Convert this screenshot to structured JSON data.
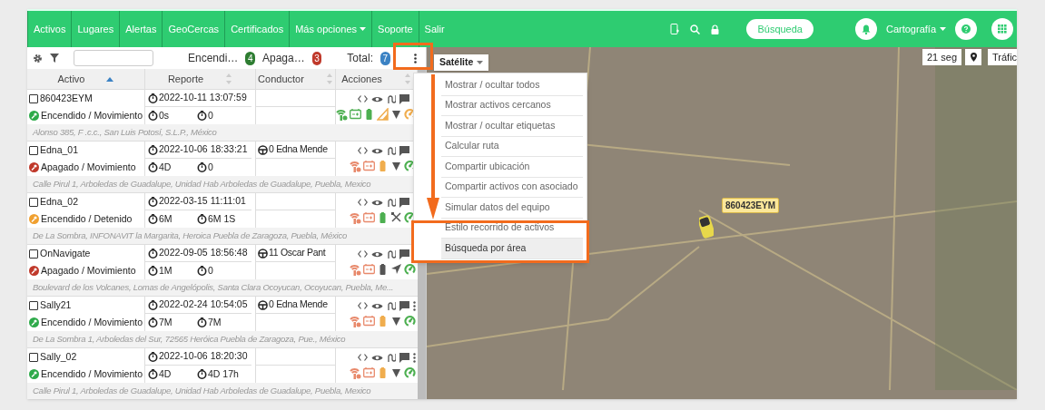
{
  "nav": {
    "items": [
      {
        "label": "Activos",
        "dropdown": false
      },
      {
        "label": "Lugares",
        "dropdown": false
      },
      {
        "label": "Alertas",
        "dropdown": false
      },
      {
        "label": "GeoCercas",
        "dropdown": false
      },
      {
        "label": "Certificados",
        "dropdown": false
      },
      {
        "label": "Más opciones",
        "dropdown": true
      },
      {
        "label": "Soporte",
        "dropdown": false
      },
      {
        "label": "Salir",
        "dropdown": false
      }
    ],
    "search_button": "Búsqueda",
    "profile_menu": "Cartografía"
  },
  "toolbar": {
    "counters": [
      {
        "label": "Encendi…",
        "count": "4",
        "color": "#2e7d32"
      },
      {
        "label": "Apaga…",
        "count": "3",
        "color": "#c0392b"
      },
      {
        "label": "Total:",
        "count": "7",
        "color": "#3b82c4"
      }
    ]
  },
  "table": {
    "columns": [
      {
        "label": "Activo",
        "sorted": true
      },
      {
        "label": "Reporte",
        "sorted": false
      },
      {
        "label": "Conductor",
        "sorted": false
      },
      {
        "label": "Acciones",
        "sorted": false
      }
    ],
    "rows": [
      {
        "name": "860423EYM",
        "checked": false,
        "status": "Encendido / Movimiento",
        "color": "#2eaa4a",
        "report": "2022-10-11 13:07:59",
        "elapsed": [
          "0s",
          "0"
        ],
        "indicators": [
          {
            "kind": "signal",
            "color": "#4caf50"
          },
          {
            "kind": "power",
            "color": "#4caf50"
          },
          {
            "kind": "battery",
            "color": "#4caf50"
          },
          {
            "kind": "strength",
            "color": "#f0ad4e"
          },
          {
            "kind": "funnel",
            "color": "#555555"
          },
          {
            "kind": "gauge",
            "color": "#f0ad4e"
          }
        ],
        "address": "Alonso 385, F .c.c., San Luis Potosí, S.L.P., México"
      },
      {
        "name": "Edna_01",
        "checked": false,
        "status": "Apagado / Movimiento",
        "color": "#c0392b",
        "report": "2022-10-06 18:33:21",
        "driver": "0 Edna Mende",
        "elapsed": [
          "4D",
          "0"
        ],
        "indicators": [
          {
            "kind": "signal",
            "color": "#e8896b"
          },
          {
            "kind": "power",
            "color": "#e8896b"
          },
          {
            "kind": "battery",
            "color": "#f0ad4e"
          },
          {
            "kind": "funnel",
            "color": "#555555"
          },
          {
            "kind": "gauge",
            "color": "#4caf50"
          }
        ],
        "address": "Calle Pirul 1, Arboledas de Guadalupe, Unidad Hab Arboledas de Guadalupe, Puebla, Mexico"
      },
      {
        "name": "Edna_02",
        "checked": false,
        "status": "Encendido / Detenido",
        "color": "#f0a030",
        "report": "2022-03-15 11:11:01",
        "elapsed": [
          "6M",
          "6M 1S"
        ],
        "indicators": [
          {
            "kind": "signal",
            "color": "#e8896b"
          },
          {
            "kind": "power",
            "color": "#e8896b"
          },
          {
            "kind": "battery",
            "color": "#4caf50"
          },
          {
            "kind": "satellite",
            "color": "#555555"
          },
          {
            "kind": "gauge",
            "color": "#4caf50"
          }
        ],
        "address": "De La Sombra, INFONAVIT la Margarita, Heroica Puebla de Zaragoza, Puebla, México"
      },
      {
        "name": "OnNavigate",
        "checked": false,
        "status": "Apagado / Movimiento",
        "color": "#c0392b",
        "report": "2022-09-05 18:56:48",
        "driver": "11 Oscar Pant",
        "elapsed": [
          "1M",
          "0"
        ],
        "indicators": [
          {
            "kind": "signal",
            "color": "#e8896b"
          },
          {
            "kind": "power",
            "color": "#e8896b"
          },
          {
            "kind": "battery",
            "color": "#555555"
          },
          {
            "kind": "navigation",
            "color": "#555555"
          },
          {
            "kind": "gauge",
            "color": "#4caf50"
          }
        ],
        "address": "Boulevard de los Volcanes, Lomas de Angelópolis, Santa Clara Ocoyucan, Ocoyucan, Puebla, Me..."
      },
      {
        "name": "Sally21",
        "checked": false,
        "status": "Encendido / Movimiento",
        "color": "#2eaa4a",
        "report": "2022-02-24 10:54:05",
        "driver": "0 Edna Mende",
        "elapsed": [
          "7M",
          "7M"
        ],
        "indicators": [
          {
            "kind": "signal",
            "color": "#e8896b"
          },
          {
            "kind": "power",
            "color": "#e8896b"
          },
          {
            "kind": "battery",
            "color": "#f0ad4e"
          },
          {
            "kind": "funnel",
            "color": "#555555"
          },
          {
            "kind": "gauge",
            "color": "#4caf50"
          }
        ],
        "address": "De La Sombra 1, Arboledas del Sur, 72565 Heróica Puebla de Zaragoza, Pue., México"
      },
      {
        "name": "Sally_02",
        "checked": false,
        "status": "Encendido / Movimiento",
        "color": "#2eaa4a",
        "report": "2022-10-06 18:20:30",
        "elapsed": [
          "4D",
          "4D 17h"
        ],
        "indicators": [
          {
            "kind": "signal",
            "color": "#e8896b"
          },
          {
            "kind": "power",
            "color": "#e8896b"
          },
          {
            "kind": "battery",
            "color": "#f0ad4e"
          },
          {
            "kind": "funnel",
            "color": "#555555"
          },
          {
            "kind": "gauge",
            "color": "#4caf50"
          }
        ],
        "address": "Calle Pirul 1, Arboledas de Guadalupe, Unidad Hab Arboledas de Guadalupe, Puebla, Mexico"
      }
    ]
  },
  "options_menu": {
    "items": [
      {
        "label": "Mostrar / ocultar todos",
        "selected": false
      },
      {
        "label": "Mostrar activos cercanos",
        "selected": false
      },
      {
        "label": "Mostrar / ocultar etiquetas",
        "selected": false
      },
      {
        "label": "Calcular ruta",
        "selected": false
      },
      {
        "label": "Compartir ubicación",
        "selected": false
      },
      {
        "label": "Compartir activos con asociado",
        "selected": false
      },
      {
        "label": "Simular datos del equipo",
        "selected": false
      },
      {
        "label": "Estilo recorrido de activos",
        "selected": false
      },
      {
        "label": "Búsqueda por área",
        "selected": true
      }
    ]
  },
  "map": {
    "layer_menu": "Satélite",
    "refresh": "21 seg",
    "traffic": "Tráfic",
    "vehicle_label": "860423EYM"
  }
}
